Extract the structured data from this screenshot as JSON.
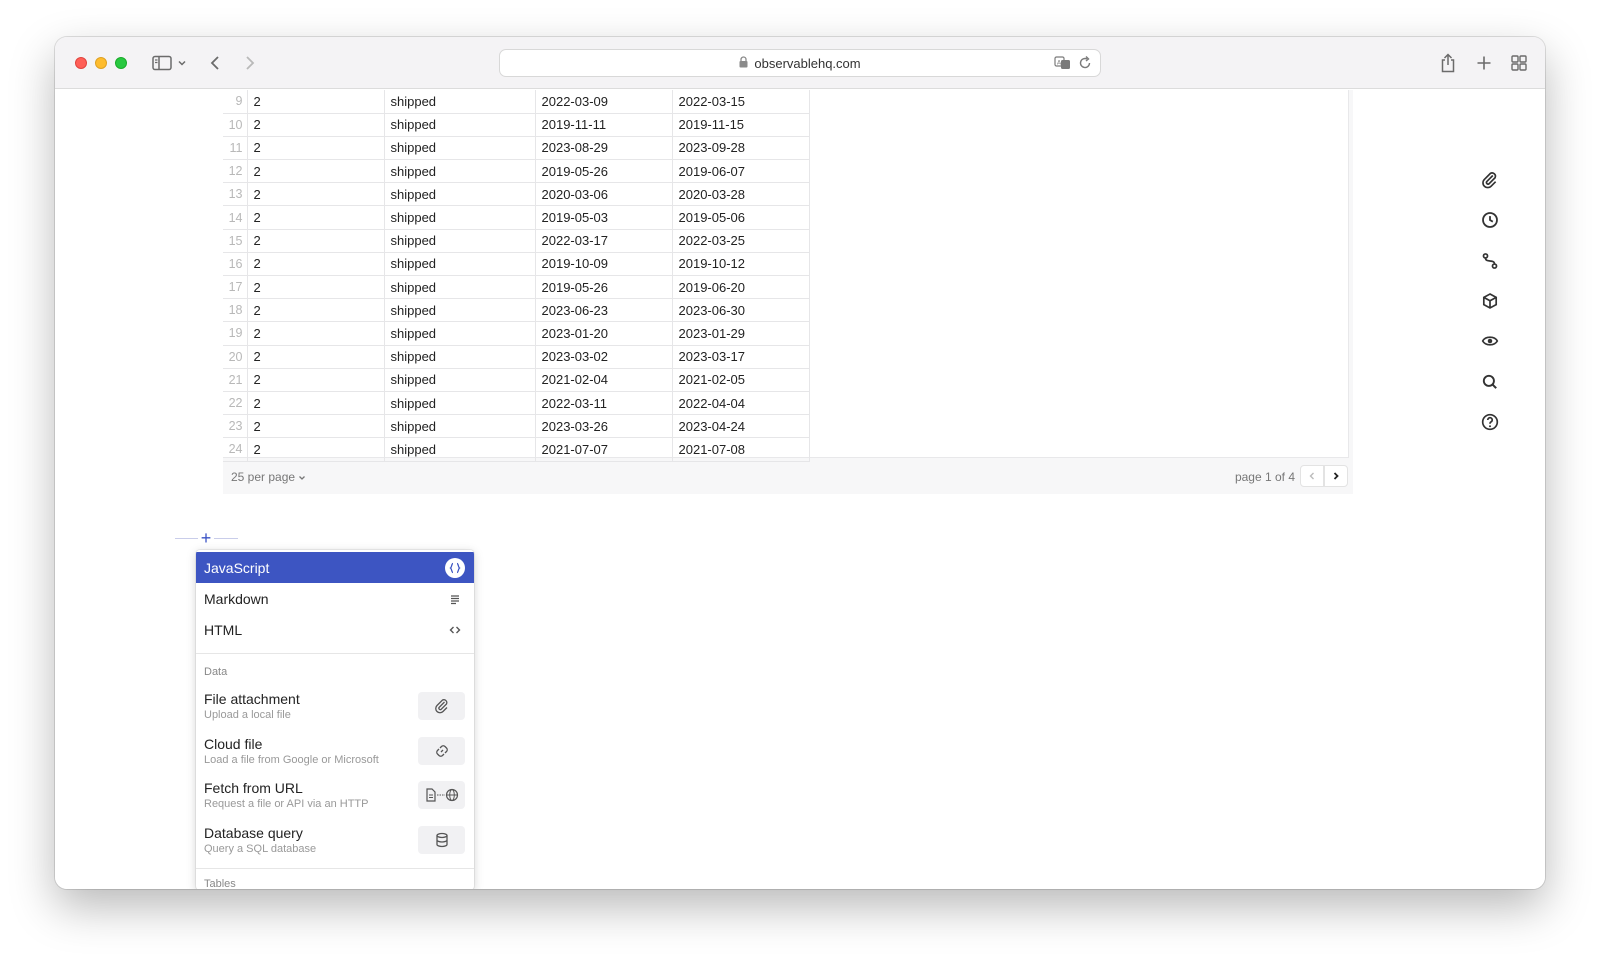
{
  "browser": {
    "url": "observablehq.com"
  },
  "table": {
    "rows": [
      {
        "n": "9",
        "a": "2",
        "status": "shipped",
        "d1": "2022-03-09",
        "d2": "2022-03-15"
      },
      {
        "n": "10",
        "a": "2",
        "status": "shipped",
        "d1": "2019-11-11",
        "d2": "2019-11-15"
      },
      {
        "n": "11",
        "a": "2",
        "status": "shipped",
        "d1": "2023-08-29",
        "d2": "2023-09-28"
      },
      {
        "n": "12",
        "a": "2",
        "status": "shipped",
        "d1": "2019-05-26",
        "d2": "2019-06-07"
      },
      {
        "n": "13",
        "a": "2",
        "status": "shipped",
        "d1": "2020-03-06",
        "d2": "2020-03-28"
      },
      {
        "n": "14",
        "a": "2",
        "status": "shipped",
        "d1": "2019-05-03",
        "d2": "2019-05-06"
      },
      {
        "n": "15",
        "a": "2",
        "status": "shipped",
        "d1": "2022-03-17",
        "d2": "2022-03-25"
      },
      {
        "n": "16",
        "a": "2",
        "status": "shipped",
        "d1": "2019-10-09",
        "d2": "2019-10-12"
      },
      {
        "n": "17",
        "a": "2",
        "status": "shipped",
        "d1": "2019-05-26",
        "d2": "2019-06-20"
      },
      {
        "n": "18",
        "a": "2",
        "status": "shipped",
        "d1": "2023-06-23",
        "d2": "2023-06-30"
      },
      {
        "n": "19",
        "a": "2",
        "status": "shipped",
        "d1": "2023-01-20",
        "d2": "2023-01-29"
      },
      {
        "n": "20",
        "a": "2",
        "status": "shipped",
        "d1": "2023-03-02",
        "d2": "2023-03-17"
      },
      {
        "n": "21",
        "a": "2",
        "status": "shipped",
        "d1": "2021-02-04",
        "d2": "2021-02-05"
      },
      {
        "n": "22",
        "a": "2",
        "status": "shipped",
        "d1": "2022-03-11",
        "d2": "2022-04-04"
      },
      {
        "n": "23",
        "a": "2",
        "status": "shipped",
        "d1": "2023-03-26",
        "d2": "2023-04-24"
      },
      {
        "n": "24",
        "a": "2",
        "status": "shipped",
        "d1": "2021-07-07",
        "d2": "2021-07-08"
      }
    ],
    "per_page": "25 per page",
    "page_info": "page 1 of 4"
  },
  "menu": {
    "languages": {
      "javascript": "JavaScript",
      "markdown": "Markdown",
      "html": "HTML"
    },
    "data_section": "Data",
    "data_items": {
      "file": {
        "title": "File attachment",
        "subtitle": "Upload a local file"
      },
      "cloud": {
        "title": "Cloud file",
        "subtitle": "Load a file from Google or Microsoft"
      },
      "fetch": {
        "title": "Fetch from URL",
        "subtitle": "Request a file or API via an HTTP"
      },
      "db": {
        "title": "Database query",
        "subtitle": "Query a SQL database"
      }
    },
    "next_section": "Tables"
  },
  "icons": {
    "right_toolbar": [
      "paperclip-icon",
      "clock-icon",
      "branch-icon",
      "package-icon",
      "eye-icon",
      "search-icon",
      "help-icon"
    ]
  },
  "colors": {
    "accent": "#3d55c2"
  }
}
